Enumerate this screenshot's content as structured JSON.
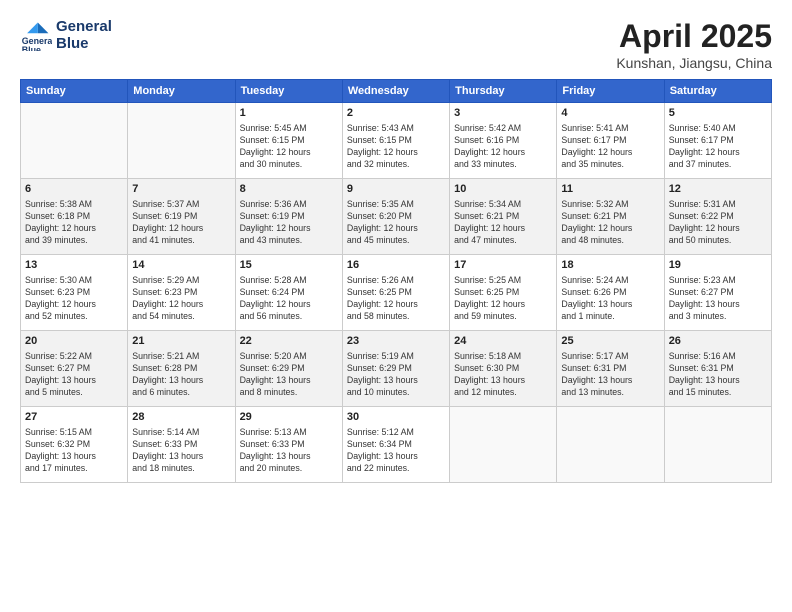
{
  "logo": {
    "line1": "General",
    "line2": "Blue"
  },
  "title": "April 2025",
  "subtitle": "Kunshan, Jiangsu, China",
  "weekdays": [
    "Sunday",
    "Monday",
    "Tuesday",
    "Wednesday",
    "Thursday",
    "Friday",
    "Saturday"
  ],
  "weeks": [
    [
      {
        "day": "",
        "info": ""
      },
      {
        "day": "",
        "info": ""
      },
      {
        "day": "1",
        "info": "Sunrise: 5:45 AM\nSunset: 6:15 PM\nDaylight: 12 hours\nand 30 minutes."
      },
      {
        "day": "2",
        "info": "Sunrise: 5:43 AM\nSunset: 6:15 PM\nDaylight: 12 hours\nand 32 minutes."
      },
      {
        "day": "3",
        "info": "Sunrise: 5:42 AM\nSunset: 6:16 PM\nDaylight: 12 hours\nand 33 minutes."
      },
      {
        "day": "4",
        "info": "Sunrise: 5:41 AM\nSunset: 6:17 PM\nDaylight: 12 hours\nand 35 minutes."
      },
      {
        "day": "5",
        "info": "Sunrise: 5:40 AM\nSunset: 6:17 PM\nDaylight: 12 hours\nand 37 minutes."
      }
    ],
    [
      {
        "day": "6",
        "info": "Sunrise: 5:38 AM\nSunset: 6:18 PM\nDaylight: 12 hours\nand 39 minutes."
      },
      {
        "day": "7",
        "info": "Sunrise: 5:37 AM\nSunset: 6:19 PM\nDaylight: 12 hours\nand 41 minutes."
      },
      {
        "day": "8",
        "info": "Sunrise: 5:36 AM\nSunset: 6:19 PM\nDaylight: 12 hours\nand 43 minutes."
      },
      {
        "day": "9",
        "info": "Sunrise: 5:35 AM\nSunset: 6:20 PM\nDaylight: 12 hours\nand 45 minutes."
      },
      {
        "day": "10",
        "info": "Sunrise: 5:34 AM\nSunset: 6:21 PM\nDaylight: 12 hours\nand 47 minutes."
      },
      {
        "day": "11",
        "info": "Sunrise: 5:32 AM\nSunset: 6:21 PM\nDaylight: 12 hours\nand 48 minutes."
      },
      {
        "day": "12",
        "info": "Sunrise: 5:31 AM\nSunset: 6:22 PM\nDaylight: 12 hours\nand 50 minutes."
      }
    ],
    [
      {
        "day": "13",
        "info": "Sunrise: 5:30 AM\nSunset: 6:23 PM\nDaylight: 12 hours\nand 52 minutes."
      },
      {
        "day": "14",
        "info": "Sunrise: 5:29 AM\nSunset: 6:23 PM\nDaylight: 12 hours\nand 54 minutes."
      },
      {
        "day": "15",
        "info": "Sunrise: 5:28 AM\nSunset: 6:24 PM\nDaylight: 12 hours\nand 56 minutes."
      },
      {
        "day": "16",
        "info": "Sunrise: 5:26 AM\nSunset: 6:25 PM\nDaylight: 12 hours\nand 58 minutes."
      },
      {
        "day": "17",
        "info": "Sunrise: 5:25 AM\nSunset: 6:25 PM\nDaylight: 12 hours\nand 59 minutes."
      },
      {
        "day": "18",
        "info": "Sunrise: 5:24 AM\nSunset: 6:26 PM\nDaylight: 13 hours\nand 1 minute."
      },
      {
        "day": "19",
        "info": "Sunrise: 5:23 AM\nSunset: 6:27 PM\nDaylight: 13 hours\nand 3 minutes."
      }
    ],
    [
      {
        "day": "20",
        "info": "Sunrise: 5:22 AM\nSunset: 6:27 PM\nDaylight: 13 hours\nand 5 minutes."
      },
      {
        "day": "21",
        "info": "Sunrise: 5:21 AM\nSunset: 6:28 PM\nDaylight: 13 hours\nand 6 minutes."
      },
      {
        "day": "22",
        "info": "Sunrise: 5:20 AM\nSunset: 6:29 PM\nDaylight: 13 hours\nand 8 minutes."
      },
      {
        "day": "23",
        "info": "Sunrise: 5:19 AM\nSunset: 6:29 PM\nDaylight: 13 hours\nand 10 minutes."
      },
      {
        "day": "24",
        "info": "Sunrise: 5:18 AM\nSunset: 6:30 PM\nDaylight: 13 hours\nand 12 minutes."
      },
      {
        "day": "25",
        "info": "Sunrise: 5:17 AM\nSunset: 6:31 PM\nDaylight: 13 hours\nand 13 minutes."
      },
      {
        "day": "26",
        "info": "Sunrise: 5:16 AM\nSunset: 6:31 PM\nDaylight: 13 hours\nand 15 minutes."
      }
    ],
    [
      {
        "day": "27",
        "info": "Sunrise: 5:15 AM\nSunset: 6:32 PM\nDaylight: 13 hours\nand 17 minutes."
      },
      {
        "day": "28",
        "info": "Sunrise: 5:14 AM\nSunset: 6:33 PM\nDaylight: 13 hours\nand 18 minutes."
      },
      {
        "day": "29",
        "info": "Sunrise: 5:13 AM\nSunset: 6:33 PM\nDaylight: 13 hours\nand 20 minutes."
      },
      {
        "day": "30",
        "info": "Sunrise: 5:12 AM\nSunset: 6:34 PM\nDaylight: 13 hours\nand 22 minutes."
      },
      {
        "day": "",
        "info": ""
      },
      {
        "day": "",
        "info": ""
      },
      {
        "day": "",
        "info": ""
      }
    ]
  ]
}
